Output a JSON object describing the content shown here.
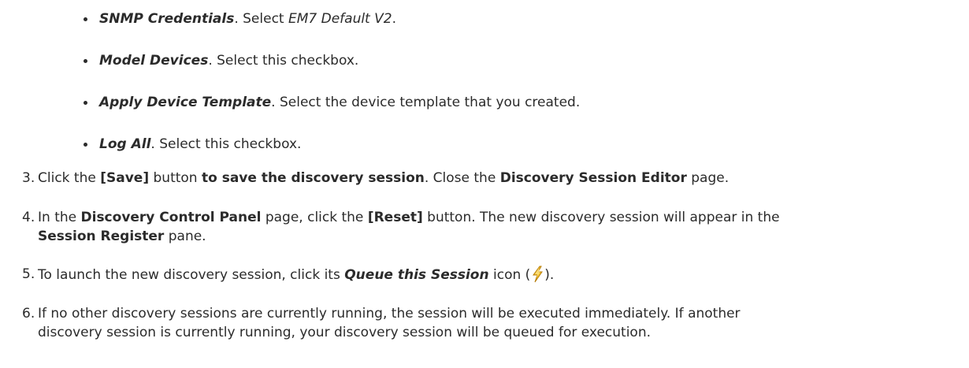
{
  "bullets": [
    {
      "term": "SNMP Credentials",
      "text1": ". Select ",
      "value": "EM7 Default V2",
      "text2": "."
    },
    {
      "term": "Model Devices",
      "text1": ". Select this checkbox."
    },
    {
      "term": "Apply Device Template",
      "text1": ". Select the device template that you created."
    },
    {
      "term": "Log All",
      "text1": ". Select this checkbox."
    }
  ],
  "steps": [
    {
      "num": "3.",
      "t1": "Click the ",
      "b1": "[Save]",
      "t2": " button ",
      "b2": "to save the discovery session",
      "t3": ". Close the ",
      "b3": "Discovery Session Editor",
      "t4": " page."
    },
    {
      "num": "4.",
      "t1": "In the ",
      "b1": "Discovery Control Panel",
      "t2": " page, click the ",
      "b2": "[Reset]",
      "t3": " button. The new discovery session will appear in the",
      "b3": "Session Register",
      "t4": " pane."
    },
    {
      "num": "5.",
      "t1": "To launch the new discovery session, click its ",
      "b1": "Queue this Session",
      "t2": " icon (",
      "icon": "lightning-bolt-icon",
      "t3": ")."
    },
    {
      "num": "6.",
      "line1": "If no other discovery sessions are currently running, the session will be executed immediately. If another",
      "line2": "discovery session is currently running, your discovery session will be queued for execution."
    }
  ],
  "colors": {
    "text": "#2b2b2b",
    "bolt_fill": "#f2c12e",
    "bolt_stroke": "#b77d0a"
  }
}
